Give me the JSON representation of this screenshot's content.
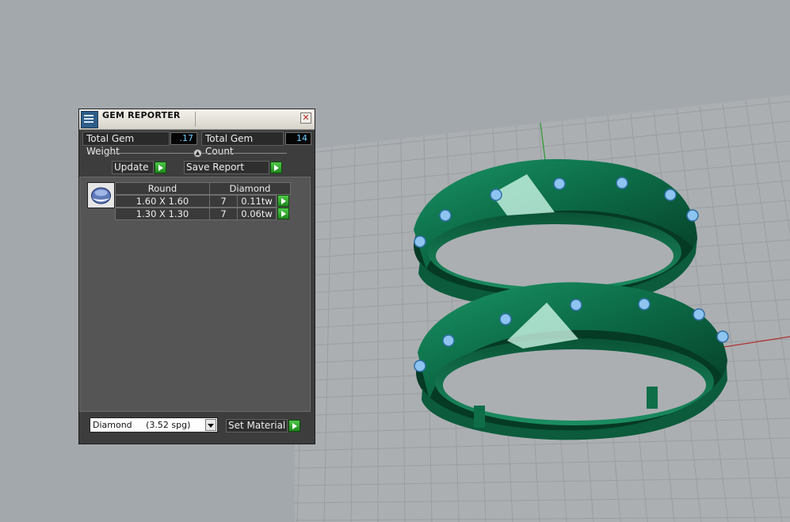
{
  "panel": {
    "title": "GEM REPORTER",
    "close_icon": "close-icon",
    "total_gem_weight_label": "Total Gem Weight",
    "total_gem_weight_value": ".17",
    "total_gem_count_label": "Total Gem Count",
    "total_gem_count_value": "14",
    "update_label": "Update",
    "save_report_label": "Save Report",
    "table": {
      "headers": [
        "Round",
        "Diamond"
      ],
      "rows": [
        {
          "size": "1.60 X 1.60",
          "count": "7",
          "weight": "0.11tw"
        },
        {
          "size": "1.30 X 1.30",
          "count": "7",
          "weight": "0.06tw"
        }
      ]
    },
    "material_select_value": "Diamond     (3.52 spg)",
    "set_material_label": "Set Material"
  },
  "colors": {
    "viewport_bg": "#a3a8ad",
    "ring_metal": "#0f7a52",
    "gem": "#8ec4f0",
    "axis_x": "#b03030",
    "axis_y": "#2d9a2d",
    "go_button": "#2fae2b"
  }
}
